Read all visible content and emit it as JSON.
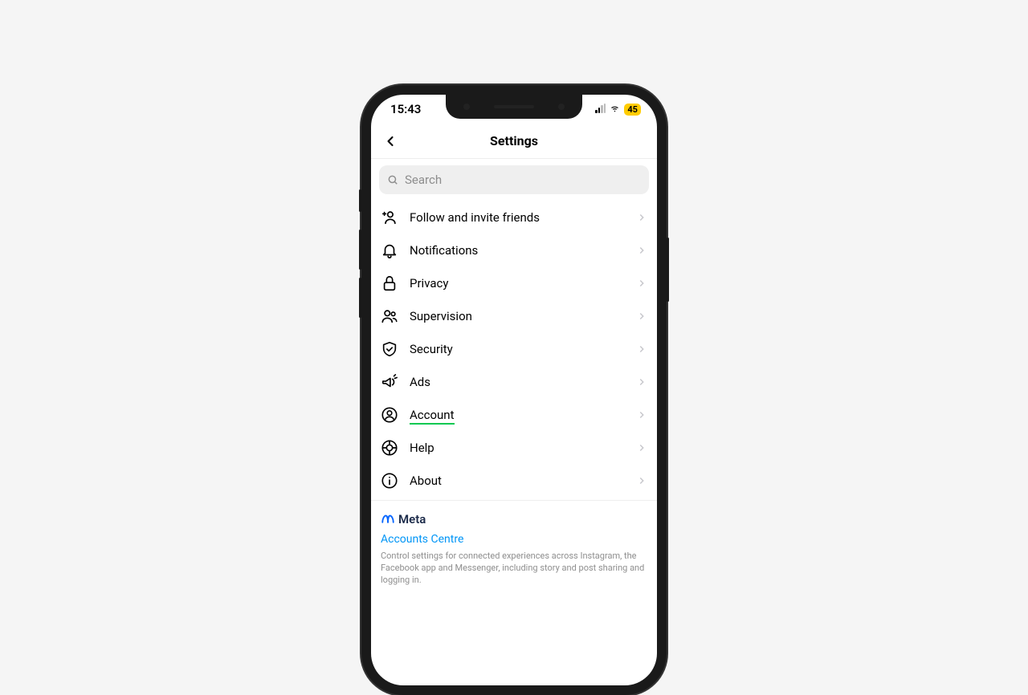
{
  "status": {
    "time": "15:43",
    "battery": "45"
  },
  "nav": {
    "title": "Settings"
  },
  "search": {
    "placeholder": "Search"
  },
  "menu": {
    "items": [
      {
        "label": "Follow and invite friends"
      },
      {
        "label": "Notifications"
      },
      {
        "label": "Privacy"
      },
      {
        "label": "Supervision"
      },
      {
        "label": "Security"
      },
      {
        "label": "Ads"
      },
      {
        "label": "Account"
      },
      {
        "label": "Help"
      },
      {
        "label": "About"
      }
    ]
  },
  "meta": {
    "brand": "Meta",
    "link": "Accounts Centre",
    "description": "Control settings for connected experiences across Instagram, the Facebook app and Messenger, including story and post sharing and logging in."
  }
}
